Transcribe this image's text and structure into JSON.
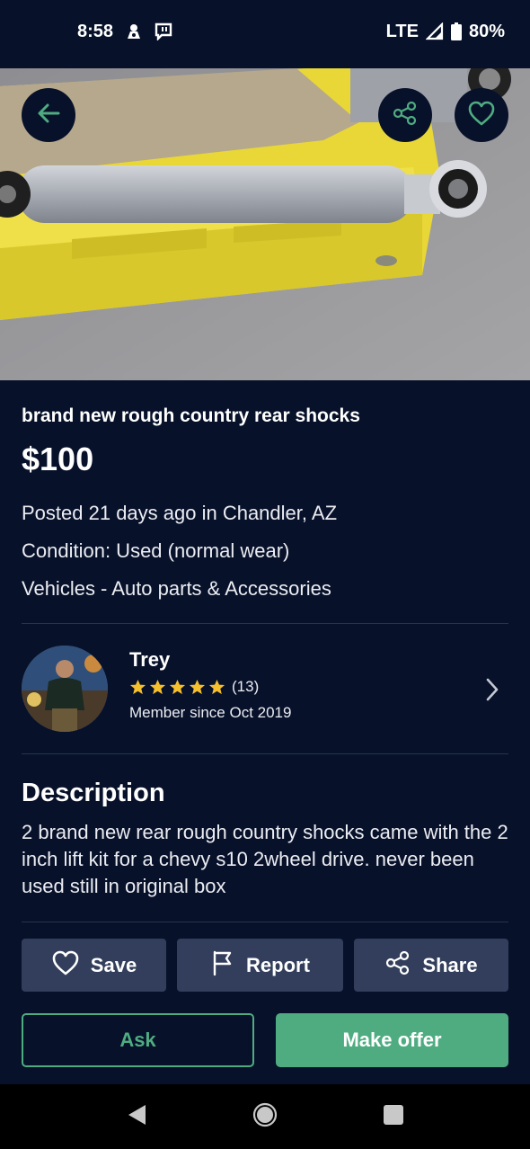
{
  "status_bar": {
    "time": "8:58",
    "network": "LTE",
    "battery": "80%",
    "icons": [
      "notification-icon",
      "chat-notification-icon",
      "signal-icon",
      "battery-icon"
    ]
  },
  "hero": {
    "buttons": [
      "back-arrow-icon",
      "share-icon",
      "heart-icon"
    ]
  },
  "listing": {
    "title": "brand new rough country rear shocks",
    "price": "$100",
    "posted": "Posted 21 days ago in Chandler, AZ",
    "condition": "Condition: Used (normal wear)",
    "category": "Vehicles - Auto parts & Accessories"
  },
  "seller": {
    "name": "Trey",
    "rating_stars": 5,
    "rating_count": "(13)",
    "member_since": "Member since Oct 2019"
  },
  "description": {
    "heading": "Description",
    "body": "2 brand new rear rough country shocks came with the 2 inch lift kit for a chevy s10 2wheel drive. never been used still in original box"
  },
  "actions": {
    "save": "Save",
    "report": "Report",
    "share": "Share",
    "ask": "Ask",
    "make_offer": "Make offer"
  },
  "colors": {
    "background": "#07112a",
    "button_bg": "#323e5b",
    "accent_green": "#4fac81",
    "star": "#f5bf2e"
  },
  "nav_bar": {
    "icons": [
      "back-triangle-icon",
      "home-circle-icon",
      "recents-square-icon"
    ]
  }
}
